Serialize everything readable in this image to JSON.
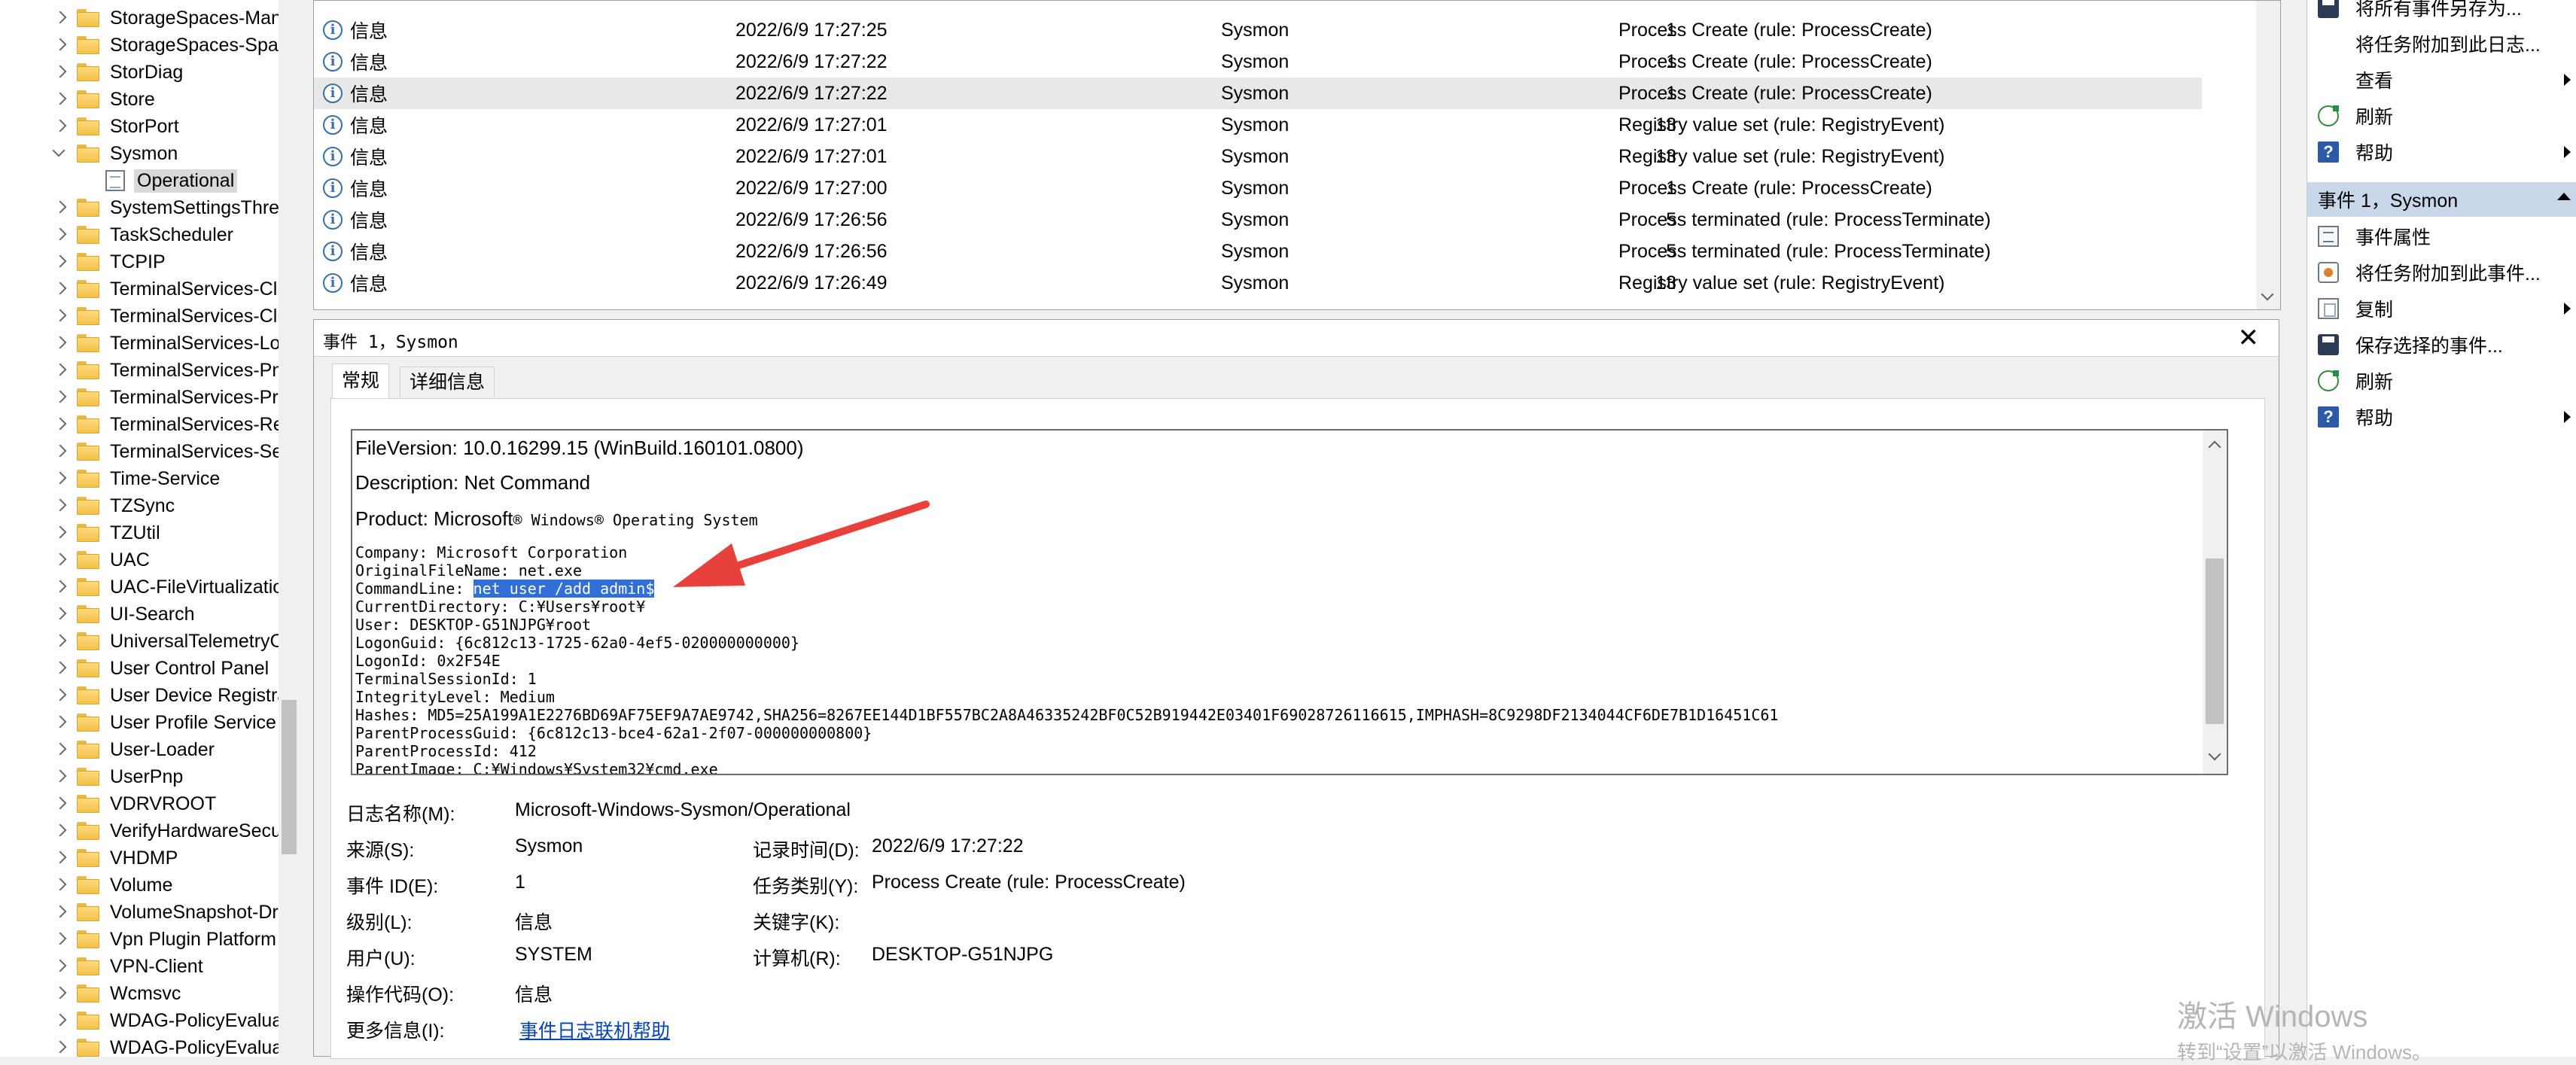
{
  "tree": {
    "items": [
      {
        "label": "StorageSpaces-Mana",
        "expandable": true
      },
      {
        "label": "StorageSpaces-Spac",
        "expandable": true
      },
      {
        "label": "StorDiag",
        "expandable": true
      },
      {
        "label": "Store",
        "expandable": true
      },
      {
        "label": "StorPort",
        "expandable": true
      },
      {
        "label": "Sysmon",
        "expandable": true,
        "expanded": true
      },
      {
        "label": "Operational",
        "child": true,
        "selected": true
      },
      {
        "label": "SystemSettingsThres",
        "expandable": true
      },
      {
        "label": "TaskScheduler",
        "expandable": true
      },
      {
        "label": "TCPIP",
        "expandable": true
      },
      {
        "label": "TerminalServices-Cli",
        "expandable": true
      },
      {
        "label": "TerminalServices-Cli",
        "expandable": true
      },
      {
        "label": "TerminalServices-Lo",
        "expandable": true
      },
      {
        "label": "TerminalServices-Pn",
        "expandable": true
      },
      {
        "label": "TerminalServices-Pri",
        "expandable": true
      },
      {
        "label": "TerminalServices-Re",
        "expandable": true
      },
      {
        "label": "TerminalServices-Se",
        "expandable": true
      },
      {
        "label": "Time-Service",
        "expandable": true
      },
      {
        "label": "TZSync",
        "expandable": true
      },
      {
        "label": "TZUtil",
        "expandable": true
      },
      {
        "label": "UAC",
        "expandable": true
      },
      {
        "label": "UAC-FileVirtualizatio",
        "expandable": true
      },
      {
        "label": "UI-Search",
        "expandable": true
      },
      {
        "label": "UniversalTelemetryC",
        "expandable": true
      },
      {
        "label": "User Control Panel",
        "expandable": true
      },
      {
        "label": "User Device Registra",
        "expandable": true
      },
      {
        "label": "User Profile Service",
        "expandable": true
      },
      {
        "label": "User-Loader",
        "expandable": true
      },
      {
        "label": "UserPnp",
        "expandable": true
      },
      {
        "label": "VDRVROOT",
        "expandable": true
      },
      {
        "label": "VerifyHardwareSecur",
        "expandable": true
      },
      {
        "label": "VHDMP",
        "expandable": true
      },
      {
        "label": "Volume",
        "expandable": true
      },
      {
        "label": "VolumeSnapshot-Dri",
        "expandable": true
      },
      {
        "label": "Vpn Plugin Platform",
        "expandable": true
      },
      {
        "label": "VPN-Client",
        "expandable": true
      },
      {
        "label": "Wcmsvc",
        "expandable": true
      },
      {
        "label": "WDAG-PolicyEvaluat",
        "expandable": true
      },
      {
        "label": "WDAG-PolicyEvaluat",
        "expandable": true
      }
    ]
  },
  "events": {
    "rows": [
      {
        "level": "信息",
        "date": "2022/6/9 17:27:25",
        "source": "Sysmon",
        "id": "1",
        "task": "Process Create (rule: ProcessCreate)"
      },
      {
        "level": "信息",
        "date": "2022/6/9 17:27:22",
        "source": "Sysmon",
        "id": "1",
        "task": "Process Create (rule: ProcessCreate)"
      },
      {
        "level": "信息",
        "date": "2022/6/9 17:27:22",
        "source": "Sysmon",
        "id": "1",
        "task": "Process Create (rule: ProcessCreate)",
        "selected": true
      },
      {
        "level": "信息",
        "date": "2022/6/9 17:27:01",
        "source": "Sysmon",
        "id": "13",
        "task": "Registry value set (rule: RegistryEvent)"
      },
      {
        "level": "信息",
        "date": "2022/6/9 17:27:01",
        "source": "Sysmon",
        "id": "13",
        "task": "Registry value set (rule: RegistryEvent)"
      },
      {
        "level": "信息",
        "date": "2022/6/9 17:27:00",
        "source": "Sysmon",
        "id": "1",
        "task": "Process Create (rule: ProcessCreate)"
      },
      {
        "level": "信息",
        "date": "2022/6/9 17:26:56",
        "source": "Sysmon",
        "id": "5",
        "task": "Process terminated (rule: ProcessTerminate)"
      },
      {
        "level": "信息",
        "date": "2022/6/9 17:26:56",
        "source": "Sysmon",
        "id": "5",
        "task": "Process terminated (rule: ProcessTerminate)"
      },
      {
        "level": "信息",
        "date": "2022/6/9 17:26:49",
        "source": "Sysmon",
        "id": "13",
        "task": "Registry value set (rule: RegistryEvent)"
      }
    ]
  },
  "detail": {
    "title": "事件 1，Sysmon",
    "close": "✕",
    "tab_general": "常规",
    "tab_details": "详细信息",
    "xml_props": [
      "FileVersion: 10.0.16299.15 (WinBuild.160101.0800)",
      "Description: Net Command"
    ],
    "product_prefix": "Product: Microsoft",
    "product_suffix": "® Windows® Operating System",
    "mono_lines": [
      "Company: Microsoft Corporation",
      "OriginalFileName: net.exe",
      "CommandLine: ",
      "CurrentDirectory: C:¥Users¥root¥",
      "User: DESKTOP-G51NJPG¥root",
      "LogonGuid: {6c812c13-1725-62a0-4ef5-020000000000}",
      "LogonId: 0x2F54E",
      "TerminalSessionId: 1",
      "IntegrityLevel: Medium",
      "Hashes: MD5=25A199A1E2276BD69AF75EF9A7AE9742,SHA256=8267EE144D1BF557BC2A8A46335242BF0C52B919442E03401F69028726116615,IMPHASH=8C9298DF2134044CF6DE7B1D16451C61",
      "ParentProcessGuid: {6c812c13-bce4-62a1-2f07-000000000800}",
      "ParentProcessId: 412",
      "ParentImage: C:¥Windows¥System32¥cmd.exe"
    ],
    "command_highlight": "net  user /add admin$",
    "fields": {
      "log_name_label": "日志名称(M):",
      "log_name": "Microsoft-Windows-Sysmon/Operational",
      "source_label": "来源(S):",
      "source": "Sysmon",
      "logged_label": "记录时间(D):",
      "logged": "2022/6/9 17:27:22",
      "event_id_label": "事件 ID(E):",
      "event_id": "1",
      "task_label": "任务类别(Y):",
      "task": "Process Create (rule: ProcessCreate)",
      "level_label": "级别(L):",
      "level": "信息",
      "keywords_label": "关键字(K):",
      "user_label": "用户(U):",
      "user": "SYSTEM",
      "computer_label": "计算机(R):",
      "computer": "DESKTOP-G51NJPG",
      "opcode_label": "操作代码(O):",
      "opcode": "信息",
      "more_label": "更多信息(I):",
      "more_link": "事件日志联机帮助"
    }
  },
  "actions": {
    "top": [
      {
        "label": "将所有事件另存为...",
        "icon": "save"
      },
      {
        "label": "将任务附加到此日志..."
      },
      {
        "label": "查看",
        "submenu": true
      },
      {
        "label": "刷新",
        "icon": "refresh"
      },
      {
        "label": "帮助",
        "icon": "help",
        "submenu": true
      }
    ],
    "section_title": "事件 1，Sysmon",
    "bottom": [
      {
        "label": "事件属性",
        "icon": "props"
      },
      {
        "label": "将任务附加到此事件...",
        "icon": "task"
      },
      {
        "label": "复制",
        "icon": "copy",
        "submenu": true
      },
      {
        "label": "保存选择的事件...",
        "icon": "save"
      },
      {
        "label": "刷新",
        "icon": "refresh"
      },
      {
        "label": "帮助",
        "icon": "help",
        "submenu": true
      }
    ]
  },
  "watermark": {
    "line1": "激活 Windows",
    "line2": "转到“设置”以激活 Windows。"
  },
  "colors": {
    "selection_highlight": "#2f6fd6",
    "annotation_arrow": "#e8413b",
    "section_header": "#c9d7ea"
  }
}
